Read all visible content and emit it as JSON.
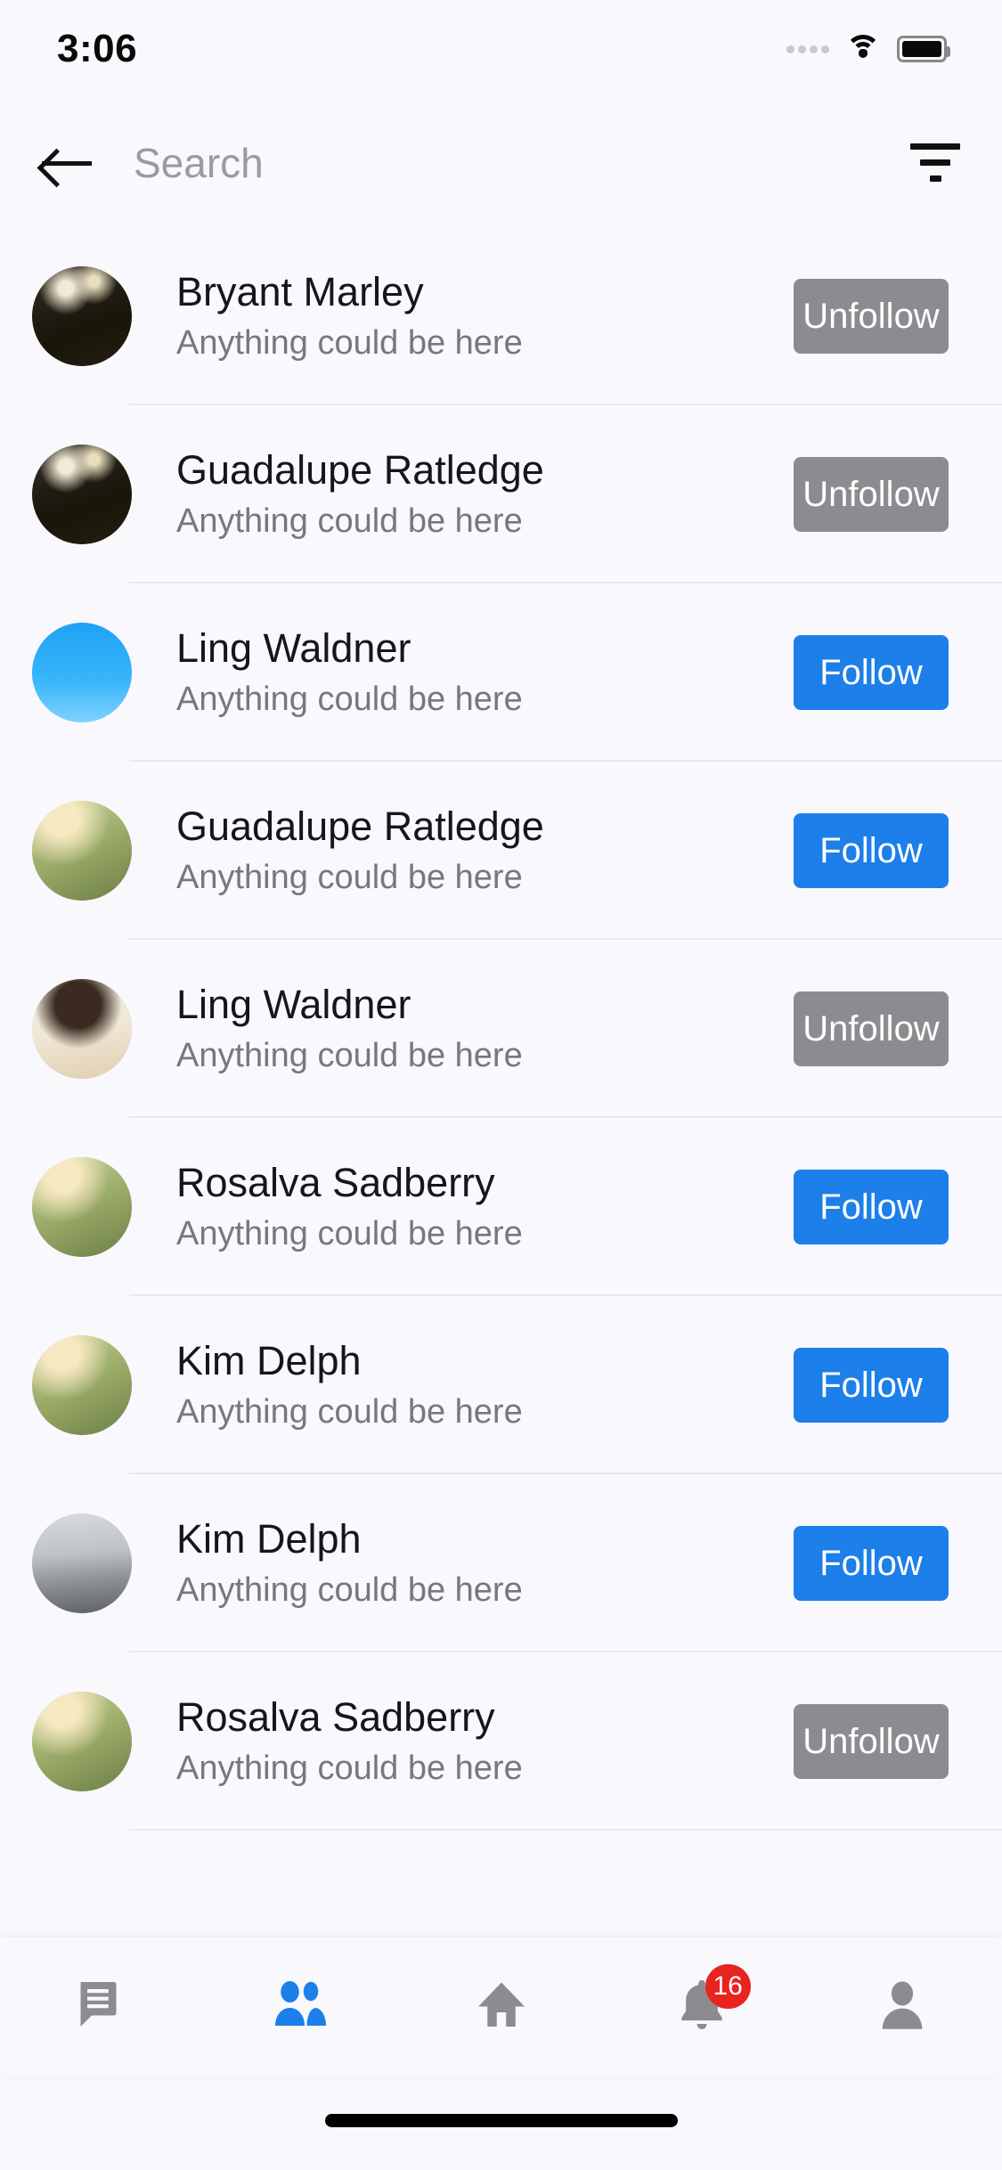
{
  "status_bar": {
    "time": "3:06",
    "signal_icon": "signal-dots-icon",
    "wifi_icon": "wifi-icon",
    "battery_icon": "battery-full-icon"
  },
  "appbar": {
    "back_icon": "back-arrow-icon",
    "search_placeholder": "Search",
    "filter_icon": "filter-icon"
  },
  "colors": {
    "background": "#F8F8FD",
    "follow": "#1C7FEA",
    "unfollow": "#8C8C90",
    "badge": "#E8241F",
    "name_text": "#16161A",
    "sub_text": "#77777F",
    "nav_active": "#1C7FEA",
    "nav_inactive": "#8C8C90",
    "divider": "#E8E8EF"
  },
  "list": {
    "subtitle_text": "Anything could be here",
    "follow_label": "Follow",
    "unfollow_label": "Unfollow",
    "rows": [
      {
        "name": "Bryant Marley",
        "subtitle": "Anything could be here",
        "action": "Unfollow",
        "state": "unfollow",
        "avatar": "woman-red-dress-forest"
      },
      {
        "name": "Guadalupe Ratledge",
        "subtitle": "Anything could be here",
        "action": "Unfollow",
        "state": "unfollow",
        "avatar": "woman-red-dress-forest"
      },
      {
        "name": "Ling Waldner",
        "subtitle": "Anything could be here",
        "action": "Follow",
        "state": "follow",
        "avatar": "woman-sunglasses-blue-sky"
      },
      {
        "name": "Guadalupe Ratledge",
        "subtitle": "Anything could be here",
        "action": "Follow",
        "state": "follow",
        "avatar": "woman-hat-field"
      },
      {
        "name": "Ling Waldner",
        "subtitle": "Anything could be here",
        "action": "Unfollow",
        "state": "unfollow",
        "avatar": "woman-smiling-cream"
      },
      {
        "name": "Rosalva Sadberry",
        "subtitle": "Anything could be here",
        "action": "Follow",
        "state": "follow",
        "avatar": "woman-hat-field"
      },
      {
        "name": "Kim Delph",
        "subtitle": "Anything could be here",
        "action": "Follow",
        "state": "follow",
        "avatar": "woman-hat-field"
      },
      {
        "name": "Kim Delph",
        "subtitle": "Anything could be here",
        "action": "Follow",
        "state": "follow",
        "avatar": "woman-airplane-gray"
      },
      {
        "name": "Rosalva Sadberry",
        "subtitle": "Anything could be here",
        "action": "Unfollow",
        "state": "unfollow",
        "avatar": "woman-hat-field"
      }
    ]
  },
  "bottom_nav": {
    "items": [
      {
        "icon": "chat-icon",
        "active": false,
        "badge": null
      },
      {
        "icon": "people-icon",
        "active": true,
        "badge": null
      },
      {
        "icon": "home-icon",
        "active": false,
        "badge": null
      },
      {
        "icon": "notification-bell-icon",
        "active": false,
        "badge": "16"
      },
      {
        "icon": "profile-person-icon",
        "active": false,
        "badge": null
      }
    ]
  }
}
